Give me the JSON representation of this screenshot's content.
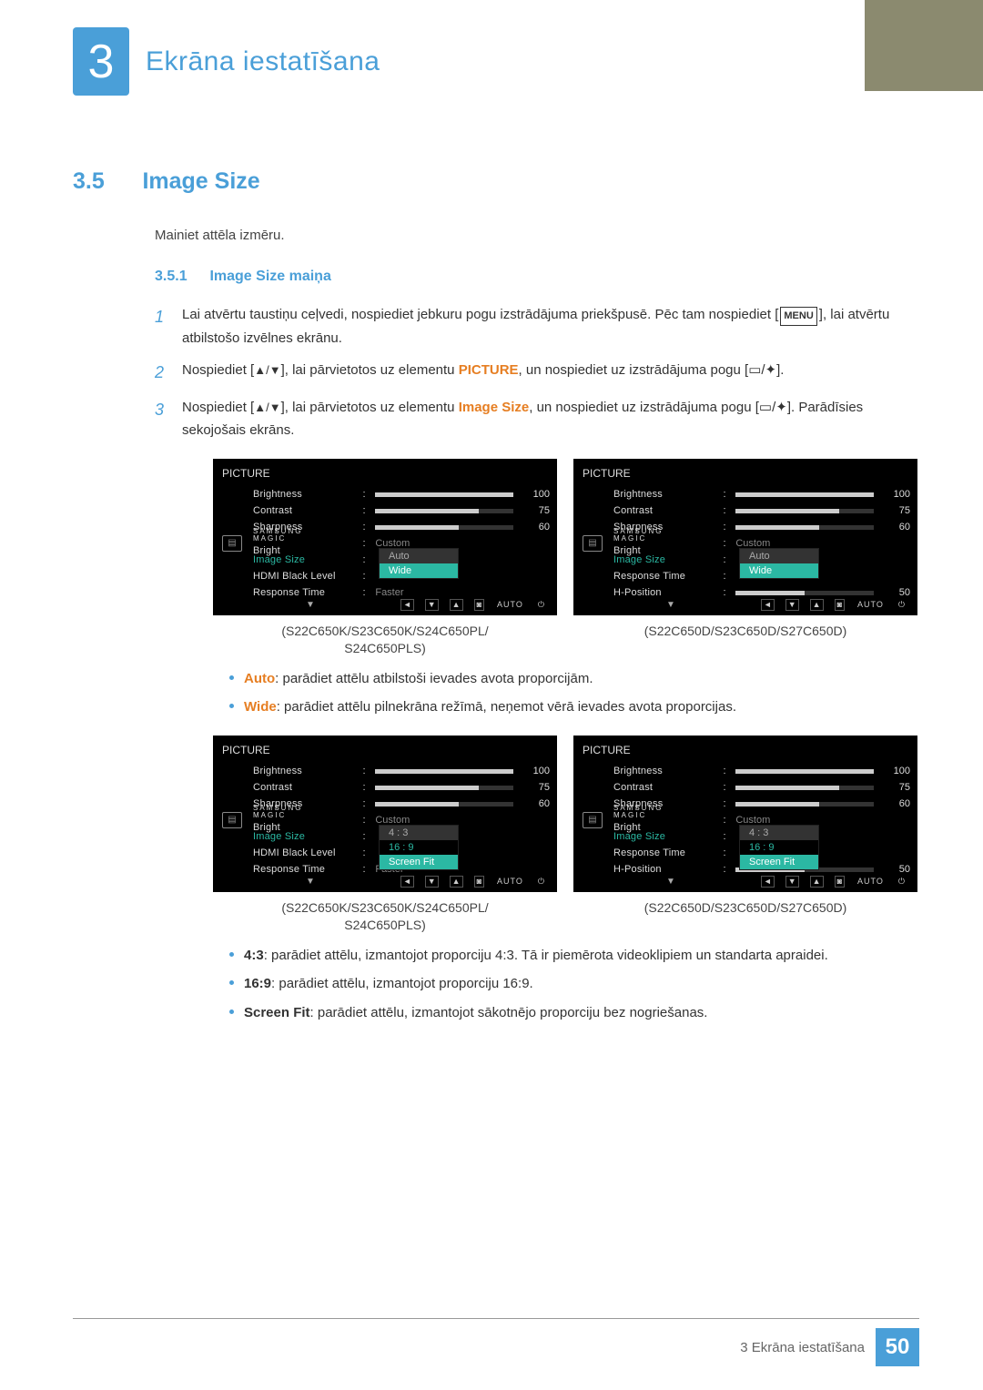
{
  "chapter": {
    "number": "3",
    "title": "Ekrāna iestatīšana"
  },
  "section": {
    "number": "3.5",
    "title": "Image Size",
    "intro": "Mainiet attēla izmēru."
  },
  "subsection": {
    "number": "3.5.1",
    "title": "Image Size maiņa"
  },
  "steps": {
    "s1": {
      "num": "1",
      "text_a": "Lai atvērtu taustiņu ceļvedi, nospiediet jebkuru pogu izstrādājuma priekšpusē. Pēc tam nospiediet [",
      "menu": "MENU",
      "text_b": "], lai atvērtu atbilstošo izvēlnes ekrānu."
    },
    "s2": {
      "num": "2",
      "text_a": "Nospiediet [",
      "arrows": "▲/▼",
      "text_b": "], lai pārvietotos uz elementu ",
      "bold": "PICTURE",
      "text_c": ", un nospiediet uz izstrādājuma pogu [",
      "text_d": "]."
    },
    "s3": {
      "num": "3",
      "text_a": "Nospiediet [",
      "arrows": "▲/▼",
      "text_b": "], lai pārvietotos uz elementu ",
      "bold": "Image Size",
      "text_c": ", un nospiediet uz izstrādājuma pogu [",
      "text_d": "]. Parādīsies sekojošais ekrāns."
    }
  },
  "osd": {
    "title": "PICTURE",
    "rows": {
      "brightness": {
        "label": "Brightness",
        "value": "100",
        "fill": 100
      },
      "contrast": {
        "label": "Contrast",
        "value": "75",
        "fill": 75
      },
      "sharpness": {
        "label": "Sharpness",
        "value": "60",
        "fill": 60
      },
      "magic": {
        "label_top": "SAMSUNG",
        "label_bottom": "MAGIC",
        "suffix": " Bright",
        "value": "Custom"
      },
      "image_size": {
        "label": "Image Size"
      },
      "hdmi_black": {
        "label": "HDMI Black Level"
      },
      "response": {
        "label": "Response Time",
        "value": "Faster"
      },
      "hposition": {
        "label": "H-Position",
        "value": "50",
        "fill": 50
      }
    },
    "popups": {
      "auto_wide": {
        "opt1": "Auto",
        "opt2": "Wide"
      },
      "aspect": {
        "opt1": "4 : 3",
        "opt2": "16 : 9",
        "opt3": "Screen Fit"
      }
    },
    "nav_auto": "AUTO"
  },
  "captions": {
    "left": "(S22C650K/S23C650K/S24C650PL/\nS24C650PLS)",
    "right": "(S22C650D/S23C650D/S27C650D)"
  },
  "bullets1": {
    "auto": {
      "bold": "Auto",
      "text": ": parādiet attēlu atbilstoši ievades avota proporcijām."
    },
    "wide": {
      "bold": "Wide",
      "text": ": parādiet attēlu pilnekrāna režīmā, neņemot vērā ievades avota proporcijas."
    }
  },
  "bullets2": {
    "r43": {
      "bold": "4:3",
      "text": ": parādiet attēlu, izmantojot proporciju 4:3. Tā ir piemērota videoklipiem un standarta apraidei."
    },
    "r169": {
      "bold": "16:9",
      "text": ": parādiet attēlu, izmantojot proporciju 16:9."
    },
    "fit": {
      "bold": "Screen Fit",
      "text": ": parādiet attēlu, izmantojot sākotnējo proporciju bez nogriešanas."
    }
  },
  "footer": {
    "text": "3 Ekrāna iestatīšana",
    "page": "50"
  }
}
